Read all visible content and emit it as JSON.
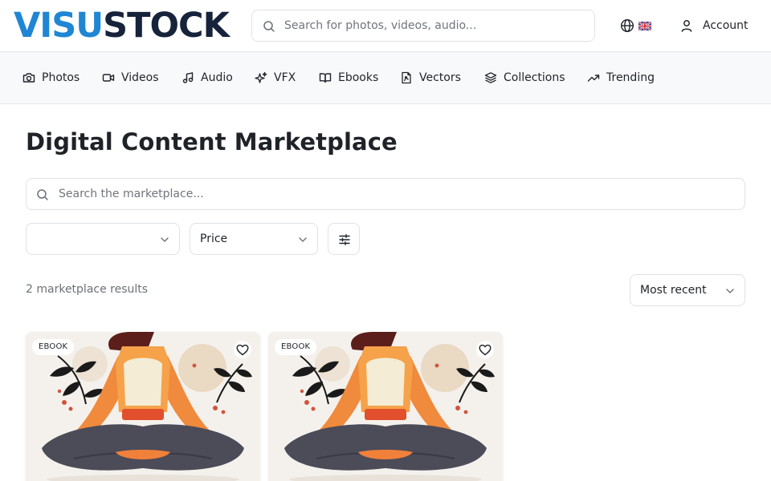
{
  "header": {
    "logo": {
      "part1": "VISU",
      "part2": "STOCK"
    },
    "search_placeholder": "Search for photos, videos, audio...",
    "account_label": "Account"
  },
  "nav": {
    "items": [
      {
        "label": "Photos",
        "icon": "camera-icon"
      },
      {
        "label": "Videos",
        "icon": "video-icon"
      },
      {
        "label": "Audio",
        "icon": "music-note-icon"
      },
      {
        "label": "VFX",
        "icon": "sparkles-icon"
      },
      {
        "label": "Ebooks",
        "icon": "open-book-icon"
      },
      {
        "label": "Vectors",
        "icon": "vector-file-icon"
      },
      {
        "label": "Collections",
        "icon": "layers-icon"
      },
      {
        "label": "Trending",
        "icon": "trending-up-icon"
      }
    ]
  },
  "main": {
    "title": "Digital Content Marketplace",
    "search_placeholder": "Search the marketplace...",
    "filters": {
      "type_value": "",
      "price_value": "Price"
    },
    "results_count": "2 marketplace results",
    "sort_value": "Most recent"
  },
  "cards": [
    {
      "badge": "EBOOK"
    },
    {
      "badge": "EBOOK"
    }
  ],
  "colors": {
    "logo_blue": "#1f86d4",
    "logo_navy": "#16233b",
    "nav_bg": "#f8f9fa",
    "border": "#dfe2e6",
    "muted_text": "#6b7178"
  }
}
